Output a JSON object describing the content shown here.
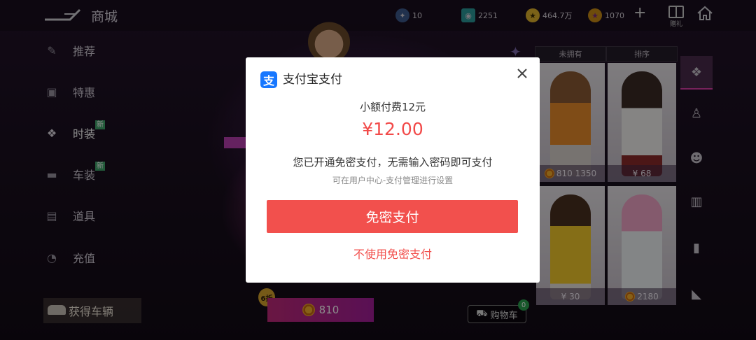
{
  "header": {
    "title": "商城",
    "resources": [
      {
        "icon": "ticket-icon",
        "value": "10"
      },
      {
        "icon": "camera-icon",
        "value": "2251"
      },
      {
        "icon": "star-coin-icon",
        "value": "464.7万"
      },
      {
        "icon": "gem-coin-icon",
        "value": "1070"
      }
    ],
    "gift_label": "赠礼"
  },
  "sidebar": {
    "items": [
      {
        "label": "推荐",
        "icon": "recommend-icon"
      },
      {
        "label": "特惠",
        "icon": "bag-icon"
      },
      {
        "label": "时装",
        "icon": "jacket-icon",
        "badge": "新"
      },
      {
        "label": "车装",
        "icon": "car-icon",
        "badge": "新"
      },
      {
        "label": "道具",
        "icon": "box-icon"
      },
      {
        "label": "充值",
        "icon": "recharge-icon"
      }
    ],
    "get_vehicle": "获得车辆"
  },
  "main": {
    "sale_badge": "6折",
    "price": "810",
    "cart_label": "购物车",
    "cart_count": "0"
  },
  "filters": {
    "tabs": [
      "未拥有",
      "排序"
    ]
  },
  "grid": {
    "items": [
      {
        "price": "810 1350"
      },
      {
        "price": "¥ 68"
      },
      {
        "price": "¥ 30"
      },
      {
        "price": "2180"
      }
    ]
  },
  "dialog": {
    "title": "支付宝支付",
    "logo_char": "支",
    "subtitle": "小额付费12元",
    "amount": "¥12.00",
    "note": "您已开通免密支付，无需输入密码即可支付",
    "hint": "可在用户中心-支付管理进行设置",
    "confirm_button": "免密支付",
    "alt_link": "不使用免密支付"
  },
  "colors": {
    "accent_red": "#f2504d",
    "alipay_blue": "#1677ff"
  }
}
